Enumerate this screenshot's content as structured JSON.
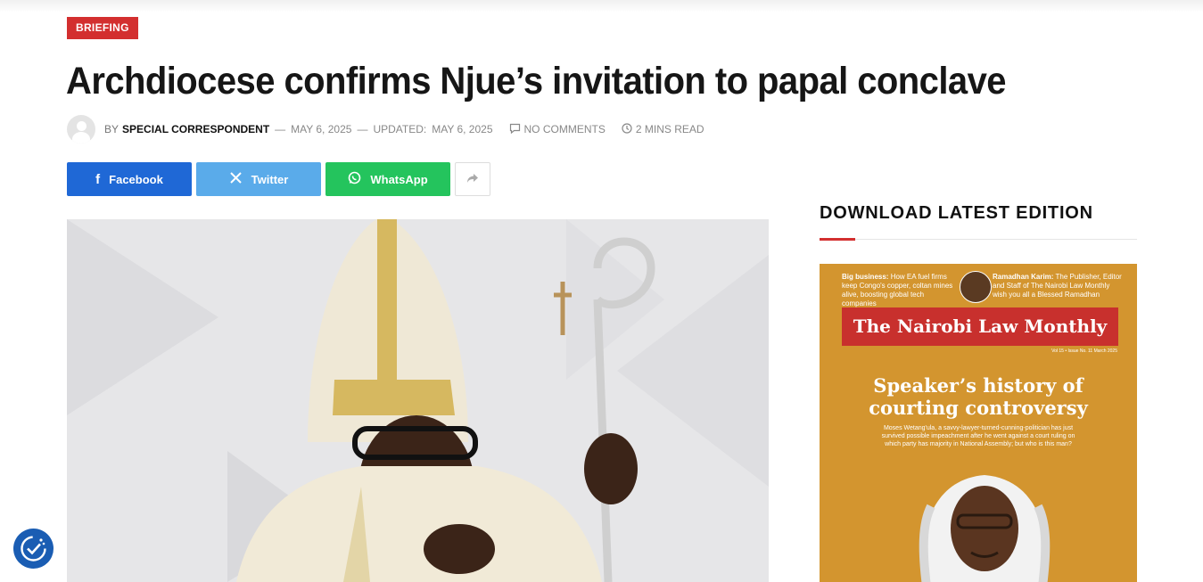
{
  "category": {
    "label": "BRIEFING"
  },
  "article": {
    "title": "Archdiocese confirms Njue’s invitation to papal conclave",
    "by": "BY",
    "author": "SPECIAL CORRESPONDENT",
    "date": "MAY 6, 2025",
    "updated_label": "UPDATED:",
    "updated_date": "MAY 6, 2025",
    "comments": "NO COMMENTS",
    "read_time": "2 MINS READ"
  },
  "share": {
    "facebook": "Facebook",
    "twitter": "Twitter",
    "whatsapp": "WhatsApp"
  },
  "sidebar": {
    "title": "DOWNLOAD LATEST EDITION",
    "cover": {
      "teaser_left_bold": "Big business:",
      "teaser_left": "How EA fuel firms keep Congo's copper, coltan mines alive, boosting global tech companies",
      "teaser_right_bold": "Ramadhan Karim:",
      "teaser_right": "The Publisher, Editor and Staff of The Nairobi Law Monthly wish you all a Blessed Ramadhan",
      "masthead": "The Nairobi Law Monthly",
      "issue": "Vol 15 • Issue No. 11 March 2025",
      "headline": "Speaker’s history of courting controversy",
      "dek": "Moses Wetang'ula, a savvy-lawyer-turned-cunning-politician has just survived possible impeachment after he went against a court ruling on which party has majority in National Assembly; but who is this man?"
    }
  },
  "colors": {
    "accent": "#d32f2f",
    "facebook": "#1f68d6",
    "twitter": "#5aabea",
    "whatsapp": "#24c45d",
    "cover_bg": "#d3952f",
    "a11y": "#1a5db3"
  },
  "icons": [
    "facebook-icon",
    "x-icon",
    "whatsapp-icon",
    "share-icon",
    "comment-icon",
    "clock-icon",
    "accessibility-icon"
  ]
}
